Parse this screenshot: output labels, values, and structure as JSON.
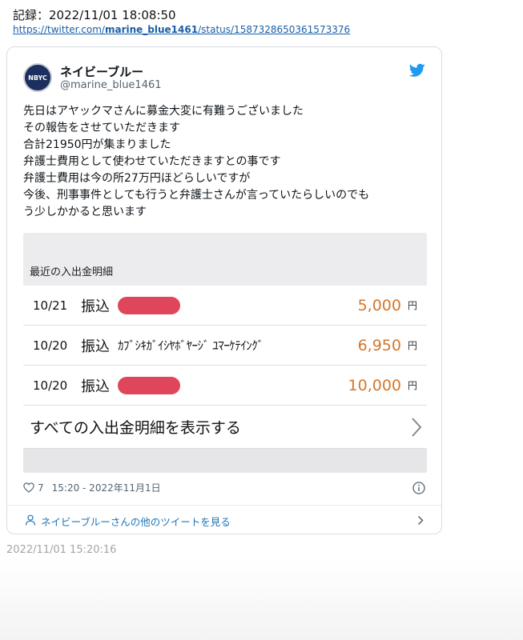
{
  "record": {
    "label": "記録：2022/11/01 18:08:50",
    "url_prefix": "https://twitter.com/",
    "url_bold": "marine_blue1461",
    "url_suffix": "/status/1587328650361573376"
  },
  "tweet": {
    "display_name": "ネイビーブルー",
    "handle": "@marine_blue1461",
    "avatar_text": "NBYC",
    "text": "先日はアヤックマさんに募金大変に有難うございました\nその報告をさせていただきます\n合計21950円が集まりました\n弁護士費用として使わせていただきますとの事です\n弁護士費用は今の所27万円ほどらしいですが\n今後、刑事事件としても行うと弁護士さんが言っていたらしいのでも\nう少しかかると思います",
    "likes": "7",
    "timestamp": "15:20 - 2022年11月1日",
    "more_label": "ネイビーブルーさんの他のツイートを見る",
    "colors": {
      "accent": "#1d9bf0",
      "link": "#1d74b5",
      "amount": "#d5772a",
      "redaction": "#e0465b"
    }
  },
  "statement": {
    "title": "最近の入出金明細",
    "rows": [
      {
        "date": "10/21",
        "type": "振込",
        "name": "",
        "amount": "5,000",
        "unit": "円",
        "redacted": true
      },
      {
        "date": "10/20",
        "type": "振込",
        "name": "ｶﾌﾞｼｷｶﾞｲｼﾔﾎﾞﾔｰｼﾞ ﾕﾏｰｹﾃｲﾝｸﾞ",
        "amount": "6,950",
        "unit": "円",
        "redacted": false
      },
      {
        "date": "10/20",
        "type": "振込",
        "name": "",
        "amount": "10,000",
        "unit": "円",
        "redacted": true
      }
    ],
    "show_all_label": "すべての入出金明細を表示する"
  },
  "saved_time": "2022/11/01 15:20:16"
}
